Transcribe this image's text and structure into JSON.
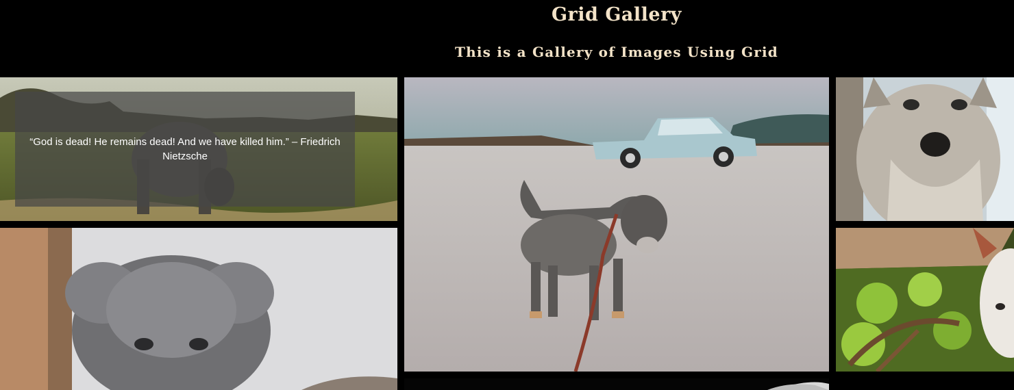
{
  "header": {
    "title": "Grid Gallery",
    "subtitle": "This is a Gallery of Images Using Grid"
  },
  "gallery": {
    "quote": "“God is dead! He remains dead! And we have killed him.” – Friedrich Nietzsche",
    "colors": {
      "background": "#000000",
      "heading": "#f3e3c8",
      "quote_overlay": "rgba(70,70,70,0.72)"
    }
  }
}
